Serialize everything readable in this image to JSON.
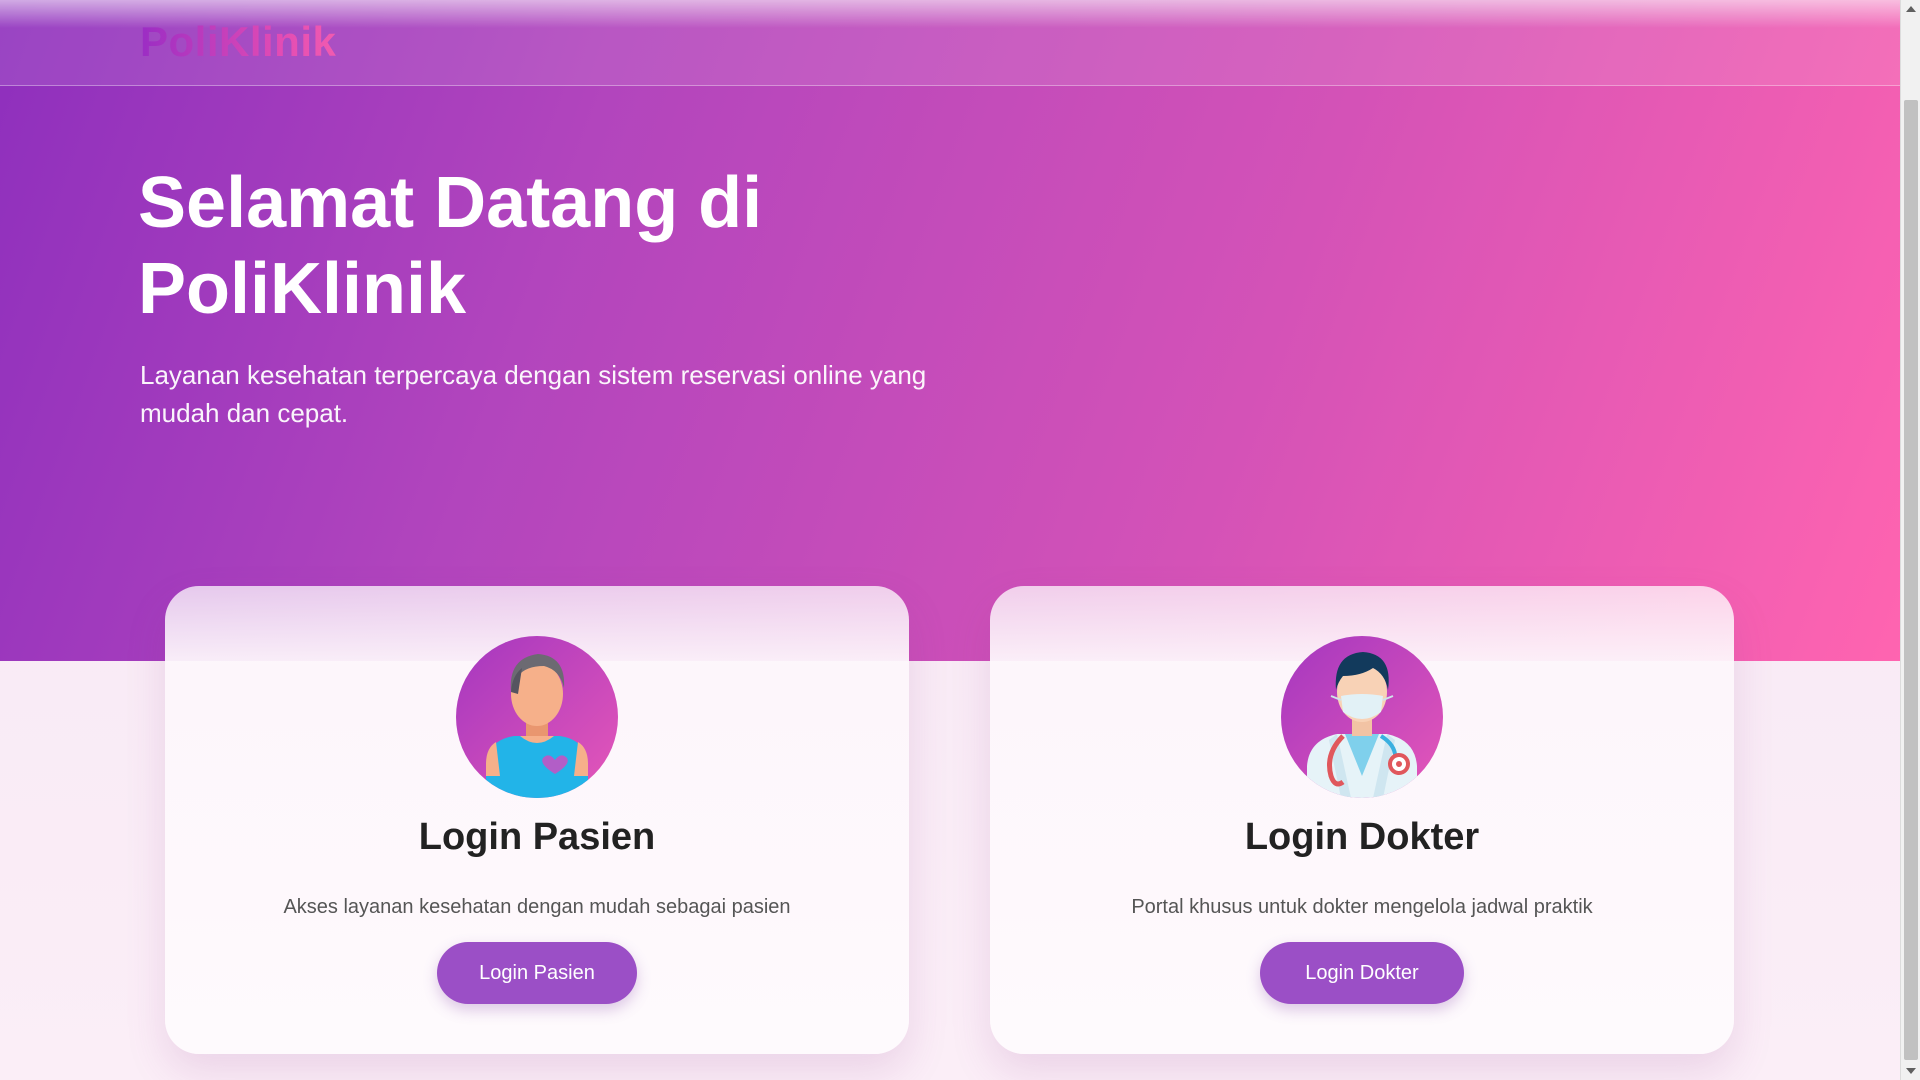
{
  "navbar": {
    "brand": "PoliKlinik"
  },
  "hero": {
    "title": "Selamat Datang di PoliKlinik",
    "subtitle": "Layanan kesehatan terpercaya dengan sistem reservasi online yang mudah dan cepat."
  },
  "cards": [
    {
      "icon": "patient-avatar-icon",
      "title": "Login Pasien",
      "description": "Akses layanan kesehatan dengan mudah sebagai pasien",
      "button_label": "Login Pasien"
    },
    {
      "icon": "doctor-avatar-icon",
      "title": "Login Dokter",
      "description": "Portal khusus untuk dokter mengelola jadwal praktik",
      "button_label": "Login Dokter"
    }
  ],
  "colors": {
    "hero_gradient_start": "#8e2fbd",
    "hero_gradient_end": "#ff64b0",
    "button": "#9b4fc6",
    "card_title": "#222222"
  }
}
